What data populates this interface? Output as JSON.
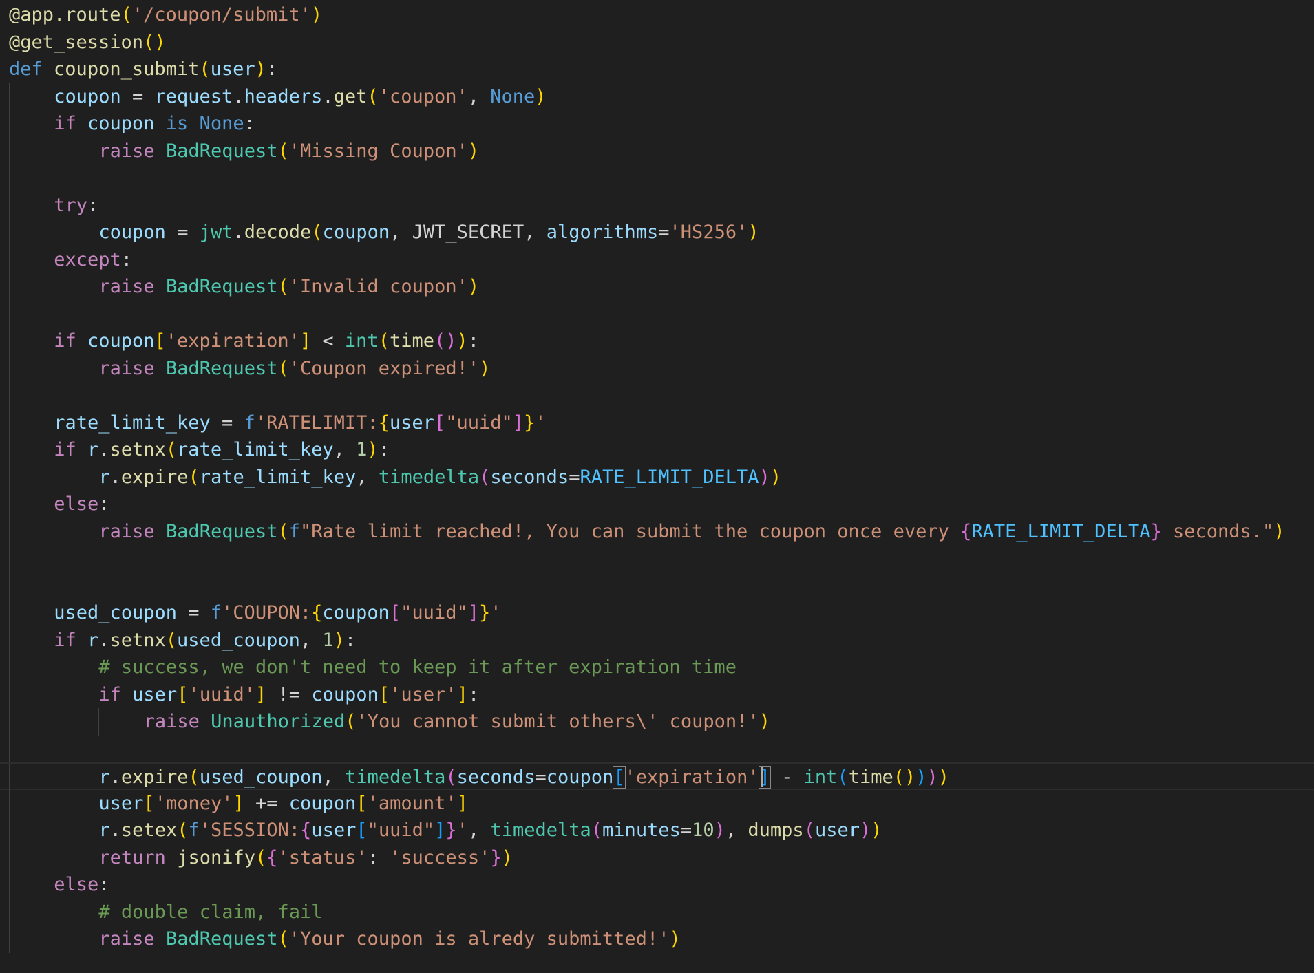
{
  "editor": {
    "language": "python",
    "theme": "dark",
    "cursor": {
      "line": 28,
      "column": 67
    },
    "colors": {
      "background": "#1f1f1f",
      "keyword": "#c586c0",
      "def": "#569cd6",
      "function": "#dcdcaa",
      "variable": "#9cdcfe",
      "string": "#ce9178",
      "number": "#b5cea8",
      "class": "#4ec9b0",
      "constant": "#4fc1ff",
      "comment": "#6a9955",
      "bracket1": "#ffd700",
      "bracket2": "#da70d6",
      "bracket3": "#179fff"
    },
    "lines": [
      {
        "indent": 0,
        "tokens": [
          [
            "fn",
            "@app.route"
          ],
          [
            "p1",
            "("
          ],
          [
            "str",
            "'/coupon/submit'"
          ],
          [
            "p1",
            ")"
          ]
        ]
      },
      {
        "indent": 0,
        "tokens": [
          [
            "fn",
            "@get_session"
          ],
          [
            "p1",
            "()"
          ]
        ]
      },
      {
        "indent": 0,
        "tokens": [
          [
            "def",
            "def"
          ],
          [
            "pl",
            " "
          ],
          [
            "fn",
            "coupon_submit"
          ],
          [
            "p1",
            "("
          ],
          [
            "var",
            "user"
          ],
          [
            "p1",
            ")"
          ],
          [
            "pl",
            ":"
          ]
        ]
      },
      {
        "indent": 1,
        "tokens": [
          [
            "var",
            "coupon"
          ],
          [
            "op",
            " = "
          ],
          [
            "var",
            "request"
          ],
          [
            "pl",
            "."
          ],
          [
            "var",
            "headers"
          ],
          [
            "pl",
            "."
          ],
          [
            "fn",
            "get"
          ],
          [
            "p1",
            "("
          ],
          [
            "str",
            "'coupon'"
          ],
          [
            "pl",
            ", "
          ],
          [
            "def",
            "None"
          ],
          [
            "p1",
            ")"
          ]
        ]
      },
      {
        "indent": 1,
        "tokens": [
          [
            "kw",
            "if"
          ],
          [
            "pl",
            " "
          ],
          [
            "var",
            "coupon"
          ],
          [
            "pl",
            " "
          ],
          [
            "def",
            "is"
          ],
          [
            "pl",
            " "
          ],
          [
            "def",
            "None"
          ],
          [
            "pl",
            ":"
          ]
        ]
      },
      {
        "indent": 2,
        "tokens": [
          [
            "kw",
            "raise"
          ],
          [
            "pl",
            " "
          ],
          [
            "cls",
            "BadRequest"
          ],
          [
            "p1",
            "("
          ],
          [
            "str",
            "'Missing Coupon'"
          ],
          [
            "p1",
            ")"
          ]
        ]
      },
      {
        "indent": 1,
        "tokens": []
      },
      {
        "indent": 1,
        "tokens": [
          [
            "kw",
            "try"
          ],
          [
            "pl",
            ":"
          ]
        ]
      },
      {
        "indent": 2,
        "tokens": [
          [
            "var",
            "coupon"
          ],
          [
            "op",
            " = "
          ],
          [
            "cls",
            "jwt"
          ],
          [
            "pl",
            "."
          ],
          [
            "fn",
            "decode"
          ],
          [
            "p1",
            "("
          ],
          [
            "var",
            "coupon"
          ],
          [
            "pl",
            ", "
          ],
          [
            "pl",
            "JWT_SECRET"
          ],
          [
            "pl",
            ", "
          ],
          [
            "var",
            "algorithms"
          ],
          [
            "op",
            "="
          ],
          [
            "str",
            "'HS256'"
          ],
          [
            "p1",
            ")"
          ]
        ]
      },
      {
        "indent": 1,
        "tokens": [
          [
            "kw",
            "except"
          ],
          [
            "pl",
            ":"
          ]
        ]
      },
      {
        "indent": 2,
        "tokens": [
          [
            "kw",
            "raise"
          ],
          [
            "pl",
            " "
          ],
          [
            "cls",
            "BadRequest"
          ],
          [
            "p1",
            "("
          ],
          [
            "str",
            "'Invalid coupon'"
          ],
          [
            "p1",
            ")"
          ]
        ]
      },
      {
        "indent": 1,
        "tokens": []
      },
      {
        "indent": 1,
        "tokens": [
          [
            "kw",
            "if"
          ],
          [
            "pl",
            " "
          ],
          [
            "var",
            "coupon"
          ],
          [
            "p1",
            "["
          ],
          [
            "str",
            "'expiration'"
          ],
          [
            "p1",
            "]"
          ],
          [
            "op",
            " < "
          ],
          [
            "cls",
            "int"
          ],
          [
            "p1",
            "("
          ],
          [
            "fn",
            "time"
          ],
          [
            "p2",
            "()"
          ],
          [
            "p1",
            ")"
          ],
          [
            "pl",
            ":"
          ]
        ]
      },
      {
        "indent": 2,
        "tokens": [
          [
            "kw",
            "raise"
          ],
          [
            "pl",
            " "
          ],
          [
            "cls",
            "BadRequest"
          ],
          [
            "p1",
            "("
          ],
          [
            "str",
            "'Coupon expired!'"
          ],
          [
            "p1",
            ")"
          ]
        ]
      },
      {
        "indent": 1,
        "tokens": []
      },
      {
        "indent": 1,
        "tokens": [
          [
            "var",
            "rate_limit_key"
          ],
          [
            "op",
            " = "
          ],
          [
            "def",
            "f"
          ],
          [
            "str",
            "'RATELIMIT:"
          ],
          [
            "p1",
            "{"
          ],
          [
            "var",
            "user"
          ],
          [
            "p2",
            "["
          ],
          [
            "str",
            "\"uuid\""
          ],
          [
            "p2",
            "]"
          ],
          [
            "p1",
            "}"
          ],
          [
            "str",
            "'"
          ]
        ]
      },
      {
        "indent": 1,
        "tokens": [
          [
            "kw",
            "if"
          ],
          [
            "pl",
            " "
          ],
          [
            "var",
            "r"
          ],
          [
            "pl",
            "."
          ],
          [
            "fn",
            "setnx"
          ],
          [
            "p1",
            "("
          ],
          [
            "var",
            "rate_limit_key"
          ],
          [
            "pl",
            ", "
          ],
          [
            "num",
            "1"
          ],
          [
            "p1",
            ")"
          ],
          [
            "pl",
            ":"
          ]
        ]
      },
      {
        "indent": 2,
        "tokens": [
          [
            "var",
            "r"
          ],
          [
            "pl",
            "."
          ],
          [
            "fn",
            "expire"
          ],
          [
            "p1",
            "("
          ],
          [
            "var",
            "rate_limit_key"
          ],
          [
            "pl",
            ", "
          ],
          [
            "cls",
            "timedelta"
          ],
          [
            "p2",
            "("
          ],
          [
            "var",
            "seconds"
          ],
          [
            "op",
            "="
          ],
          [
            "const",
            "RATE_LIMIT_DELTA"
          ],
          [
            "p2",
            ")"
          ],
          [
            "p1",
            ")"
          ]
        ]
      },
      {
        "indent": 1,
        "tokens": [
          [
            "kw",
            "else"
          ],
          [
            "pl",
            ":"
          ]
        ]
      },
      {
        "indent": 2,
        "tokens": [
          [
            "kw",
            "raise"
          ],
          [
            "pl",
            " "
          ],
          [
            "cls",
            "BadRequest"
          ],
          [
            "p1",
            "("
          ],
          [
            "def",
            "f"
          ],
          [
            "str",
            "\"Rate limit reached!, You can submit the coupon once every "
          ],
          [
            "p2",
            "{"
          ],
          [
            "const",
            "RATE_LIMIT_DELTA"
          ],
          [
            "p2",
            "}"
          ],
          [
            "str",
            " seconds.\""
          ],
          [
            "p1",
            ")"
          ]
        ]
      },
      {
        "indent": 1,
        "tokens": []
      },
      {
        "indent": 1,
        "tokens": []
      },
      {
        "indent": 1,
        "tokens": [
          [
            "var",
            "used_coupon"
          ],
          [
            "op",
            " = "
          ],
          [
            "def",
            "f"
          ],
          [
            "str",
            "'COUPON:"
          ],
          [
            "p1",
            "{"
          ],
          [
            "var",
            "coupon"
          ],
          [
            "p2",
            "["
          ],
          [
            "str",
            "\"uuid\""
          ],
          [
            "p2",
            "]"
          ],
          [
            "p1",
            "}"
          ],
          [
            "str",
            "'"
          ]
        ]
      },
      {
        "indent": 1,
        "tokens": [
          [
            "kw",
            "if"
          ],
          [
            "pl",
            " "
          ],
          [
            "var",
            "r"
          ],
          [
            "pl",
            "."
          ],
          [
            "fn",
            "setnx"
          ],
          [
            "p1",
            "("
          ],
          [
            "var",
            "used_coupon"
          ],
          [
            "pl",
            ", "
          ],
          [
            "num",
            "1"
          ],
          [
            "p1",
            ")"
          ],
          [
            "pl",
            ":"
          ]
        ]
      },
      {
        "indent": 2,
        "tokens": [
          [
            "com",
            "# success, we don't need to keep it after expiration time"
          ]
        ]
      },
      {
        "indent": 2,
        "tokens": [
          [
            "kw",
            "if"
          ],
          [
            "pl",
            " "
          ],
          [
            "var",
            "user"
          ],
          [
            "p1",
            "["
          ],
          [
            "str",
            "'uuid'"
          ],
          [
            "p1",
            "]"
          ],
          [
            "op",
            " != "
          ],
          [
            "var",
            "coupon"
          ],
          [
            "p1",
            "["
          ],
          [
            "str",
            "'user'"
          ],
          [
            "p1",
            "]"
          ],
          [
            "pl",
            ":"
          ]
        ]
      },
      {
        "indent": 3,
        "tokens": [
          [
            "kw",
            "raise"
          ],
          [
            "pl",
            " "
          ],
          [
            "cls",
            "Unauthorized"
          ],
          [
            "p1",
            "("
          ],
          [
            "str",
            "'You cannot submit others\\' coupon!'"
          ],
          [
            "p1",
            ")"
          ]
        ]
      },
      {
        "indent": 2,
        "tokens": []
      },
      {
        "indent": 2,
        "current": true,
        "tokens": [
          [
            "var",
            "r"
          ],
          [
            "pl",
            "."
          ],
          [
            "fn",
            "expire"
          ],
          [
            "p1",
            "("
          ],
          [
            "var",
            "used_coupon"
          ],
          [
            "pl",
            ", "
          ],
          [
            "cls",
            "timedelta"
          ],
          [
            "p2",
            "("
          ],
          [
            "var",
            "seconds"
          ],
          [
            "op",
            "="
          ],
          [
            "var",
            "coupon"
          ],
          [
            "p3m",
            "["
          ],
          [
            "str",
            "'expiration'"
          ],
          [
            "p3m",
            "]"
          ],
          [
            "op",
            " - "
          ],
          [
            "cls",
            "int"
          ],
          [
            "p3",
            "("
          ],
          [
            "fn",
            "time"
          ],
          [
            "p1",
            "()"
          ],
          [
            "p3",
            ")"
          ],
          [
            "p2",
            ")"
          ],
          [
            "p1",
            ")"
          ]
        ]
      },
      {
        "indent": 2,
        "tokens": [
          [
            "var",
            "user"
          ],
          [
            "p1",
            "["
          ],
          [
            "str",
            "'money'"
          ],
          [
            "p1",
            "]"
          ],
          [
            "op",
            " += "
          ],
          [
            "var",
            "coupon"
          ],
          [
            "p1",
            "["
          ],
          [
            "str",
            "'amount'"
          ],
          [
            "p1",
            "]"
          ]
        ]
      },
      {
        "indent": 2,
        "tokens": [
          [
            "var",
            "r"
          ],
          [
            "pl",
            "."
          ],
          [
            "fn",
            "setex"
          ],
          [
            "p1",
            "("
          ],
          [
            "def",
            "f"
          ],
          [
            "str",
            "'SESSION:"
          ],
          [
            "p2",
            "{"
          ],
          [
            "var",
            "user"
          ],
          [
            "p3",
            "["
          ],
          [
            "str",
            "\"uuid\""
          ],
          [
            "p3",
            "]"
          ],
          [
            "p2",
            "}"
          ],
          [
            "str",
            "'"
          ],
          [
            "pl",
            ", "
          ],
          [
            "cls",
            "timedelta"
          ],
          [
            "p2",
            "("
          ],
          [
            "var",
            "minutes"
          ],
          [
            "op",
            "="
          ],
          [
            "num",
            "10"
          ],
          [
            "p2",
            ")"
          ],
          [
            "pl",
            ", "
          ],
          [
            "fn",
            "dumps"
          ],
          [
            "p2",
            "("
          ],
          [
            "var",
            "user"
          ],
          [
            "p2",
            ")"
          ],
          [
            "p1",
            ")"
          ]
        ]
      },
      {
        "indent": 2,
        "tokens": [
          [
            "kw",
            "return"
          ],
          [
            "pl",
            " "
          ],
          [
            "fn",
            "jsonify"
          ],
          [
            "p1",
            "("
          ],
          [
            "p2",
            "{"
          ],
          [
            "str",
            "'status'"
          ],
          [
            "pl",
            ": "
          ],
          [
            "str",
            "'success'"
          ],
          [
            "p2",
            "}"
          ],
          [
            "p1",
            ")"
          ]
        ]
      },
      {
        "indent": 1,
        "tokens": [
          [
            "kw",
            "else"
          ],
          [
            "pl",
            ":"
          ]
        ]
      },
      {
        "indent": 2,
        "tokens": [
          [
            "com",
            "# double claim, fail"
          ]
        ]
      },
      {
        "indent": 2,
        "tokens": [
          [
            "kw",
            "raise"
          ],
          [
            "pl",
            " "
          ],
          [
            "cls",
            "BadRequest"
          ],
          [
            "p1",
            "("
          ],
          [
            "str",
            "'Your coupon is alredy submitted!'"
          ],
          [
            "p1",
            ")"
          ]
        ]
      }
    ]
  }
}
